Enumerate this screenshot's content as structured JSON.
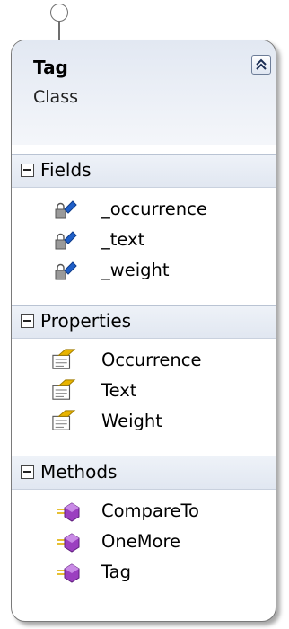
{
  "class": {
    "name": "Tag",
    "stereotype": "Class",
    "collapse_icon": "double-chevron-up-icon"
  },
  "sections": [
    {
      "label": "Fields",
      "icon": "collapse-minus-icon",
      "members": [
        {
          "label": "_occurrence",
          "icon": "private-field-icon"
        },
        {
          "label": "_text",
          "icon": "private-field-icon"
        },
        {
          "label": "_weight",
          "icon": "private-field-icon"
        }
      ]
    },
    {
      "label": "Properties",
      "icon": "collapse-minus-icon",
      "members": [
        {
          "label": "Occurrence",
          "icon": "property-icon"
        },
        {
          "label": "Text",
          "icon": "property-icon"
        },
        {
          "label": "Weight",
          "icon": "property-icon"
        }
      ]
    },
    {
      "label": "Methods",
      "icon": "collapse-minus-icon",
      "members": [
        {
          "label": "CompareTo",
          "icon": "method-icon"
        },
        {
          "label": "OneMore",
          "icon": "method-icon"
        },
        {
          "label": "Tag",
          "icon": "method-icon"
        }
      ]
    }
  ],
  "colors": {
    "border": "#7a7a7a",
    "header_gradient_top": "#e2e8f2",
    "field_icon_blue": "#1f5fc8",
    "property_icon_yellow": "#e8b400",
    "method_icon_purple": "#9b3fc0"
  }
}
